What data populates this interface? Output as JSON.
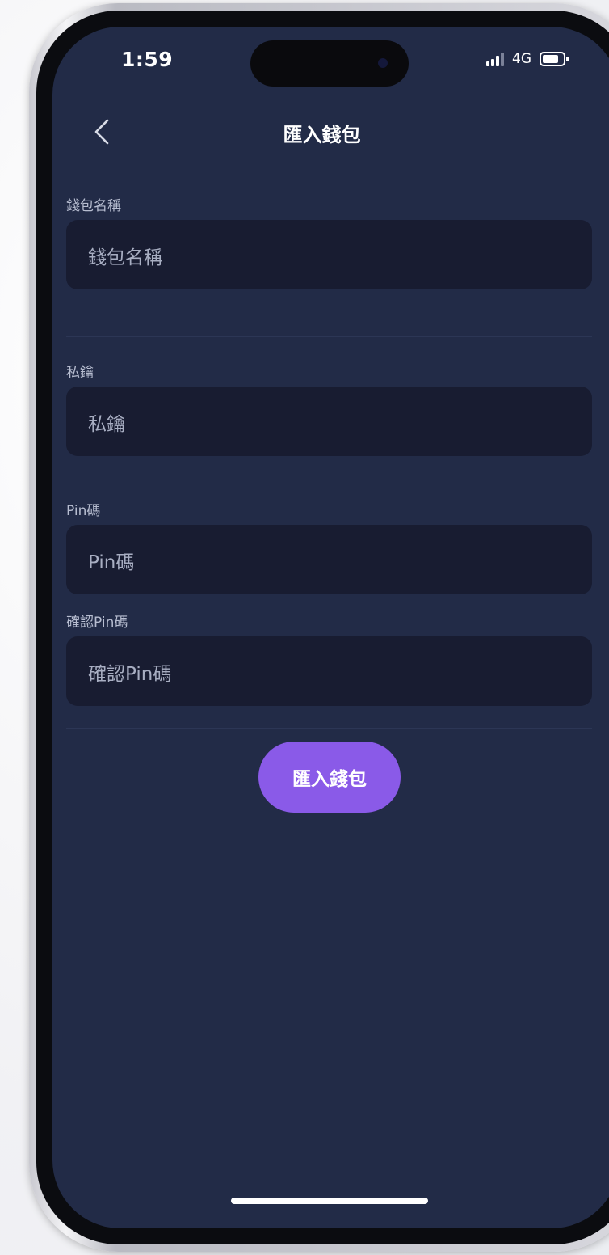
{
  "status_bar": {
    "time": "1:59",
    "network": "4G",
    "battery_level": 0.8
  },
  "header": {
    "title": "匯入錢包",
    "back_icon": "chevron-left-icon"
  },
  "form": {
    "wallet_name": {
      "label": "錢包名稱",
      "placeholder": "錢包名稱"
    },
    "private_key": {
      "label": "私鑰",
      "placeholder": "私鑰"
    },
    "pin": {
      "label": "Pin碼",
      "placeholder": "Pin碼"
    },
    "confirm_pin": {
      "label": "確認Pin碼",
      "placeholder": "確認Pin碼"
    }
  },
  "submit_label": "匯入錢包",
  "colors": {
    "background": "#222b47",
    "field": "#181c31",
    "accent": "#8a5ae8"
  }
}
